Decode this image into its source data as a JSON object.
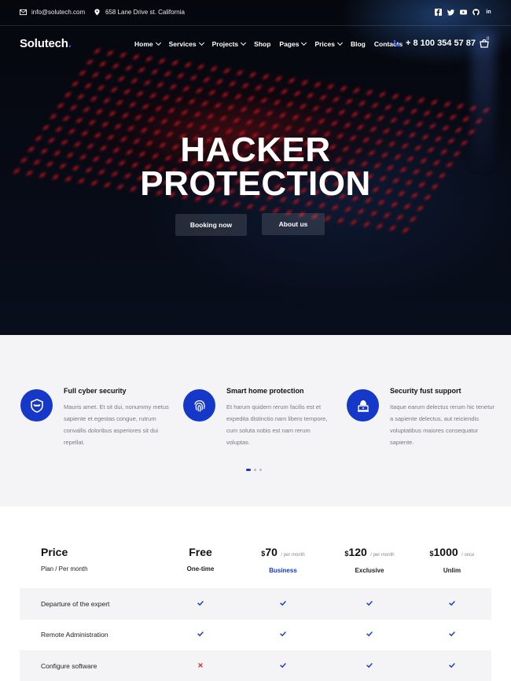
{
  "topbar": {
    "email": "info@solutech.com",
    "address": "658 Lane Drive st. California",
    "socials": [
      "facebook-icon",
      "twitter-icon",
      "youtube-icon",
      "github-icon",
      "linkedin-icon"
    ]
  },
  "header": {
    "logo": "Solutech",
    "nav": [
      {
        "label": "Home",
        "dropdown": true
      },
      {
        "label": "Services",
        "dropdown": true
      },
      {
        "label": "Projects",
        "dropdown": true
      },
      {
        "label": "Shop",
        "dropdown": false
      },
      {
        "label": "Pages",
        "dropdown": true
      },
      {
        "label": "Prices",
        "dropdown": true
      },
      {
        "label": "Blog",
        "dropdown": false
      },
      {
        "label": "Contacts",
        "dropdown": false
      }
    ],
    "phone": "+ 8 100 354 57 87",
    "cart_count": "0"
  },
  "hero": {
    "line1": "HACKER",
    "line2": "PROTECTION",
    "btn_primary": "Booking now",
    "btn_secondary": "About us"
  },
  "features": [
    {
      "icon": "shield-mask-icon",
      "title": "Full cyber security",
      "text": "Mauris amet. Et sit dui, nonummy metus sapiente et egestas congue, rutrum convallis doloribus asperiores sit dui repellat."
    },
    {
      "icon": "fingerprint-icon",
      "title": "Smart home protection",
      "text": "Et harum quidem rerum facilis est et expedita distinctio nam libero tempore, cum soluta nobis est nam rerum voluptas."
    },
    {
      "icon": "hacker-laptop-icon",
      "title": "Security fust support",
      "text": "Itaque earum delectus rerum hic tenetur a sapiente delectus, aut reiciendis voluptatibus maiores consequatur sapiente."
    }
  ],
  "carousel": {
    "active_index": 0,
    "count": 3
  },
  "pricing": {
    "title": "Price",
    "subtitle": "Plan / Per month",
    "plans": [
      {
        "price": "Free",
        "currency": "",
        "per": "",
        "name": "One-time",
        "highlight": false
      },
      {
        "price": "70",
        "currency": "$",
        "per": "/ per month",
        "name": "Business",
        "highlight": true
      },
      {
        "price": "120",
        "currency": "$",
        "per": "/ per month",
        "name": "Exclusive",
        "highlight": false
      },
      {
        "price": "1000",
        "currency": "$",
        "per": "/ once",
        "name": "Unlim",
        "highlight": false
      }
    ],
    "rows": [
      {
        "label": "Departure of the expert",
        "values": [
          true,
          true,
          true,
          true
        ]
      },
      {
        "label": "Remote Administration",
        "values": [
          true,
          true,
          true,
          true
        ]
      },
      {
        "label": "Configure software",
        "values": [
          false,
          true,
          true,
          true
        ]
      }
    ]
  },
  "colors": {
    "accent": "#1538c8",
    "check": "#1538c8",
    "cross": "#e0312b",
    "feature_bg": "#f4f4f6"
  }
}
